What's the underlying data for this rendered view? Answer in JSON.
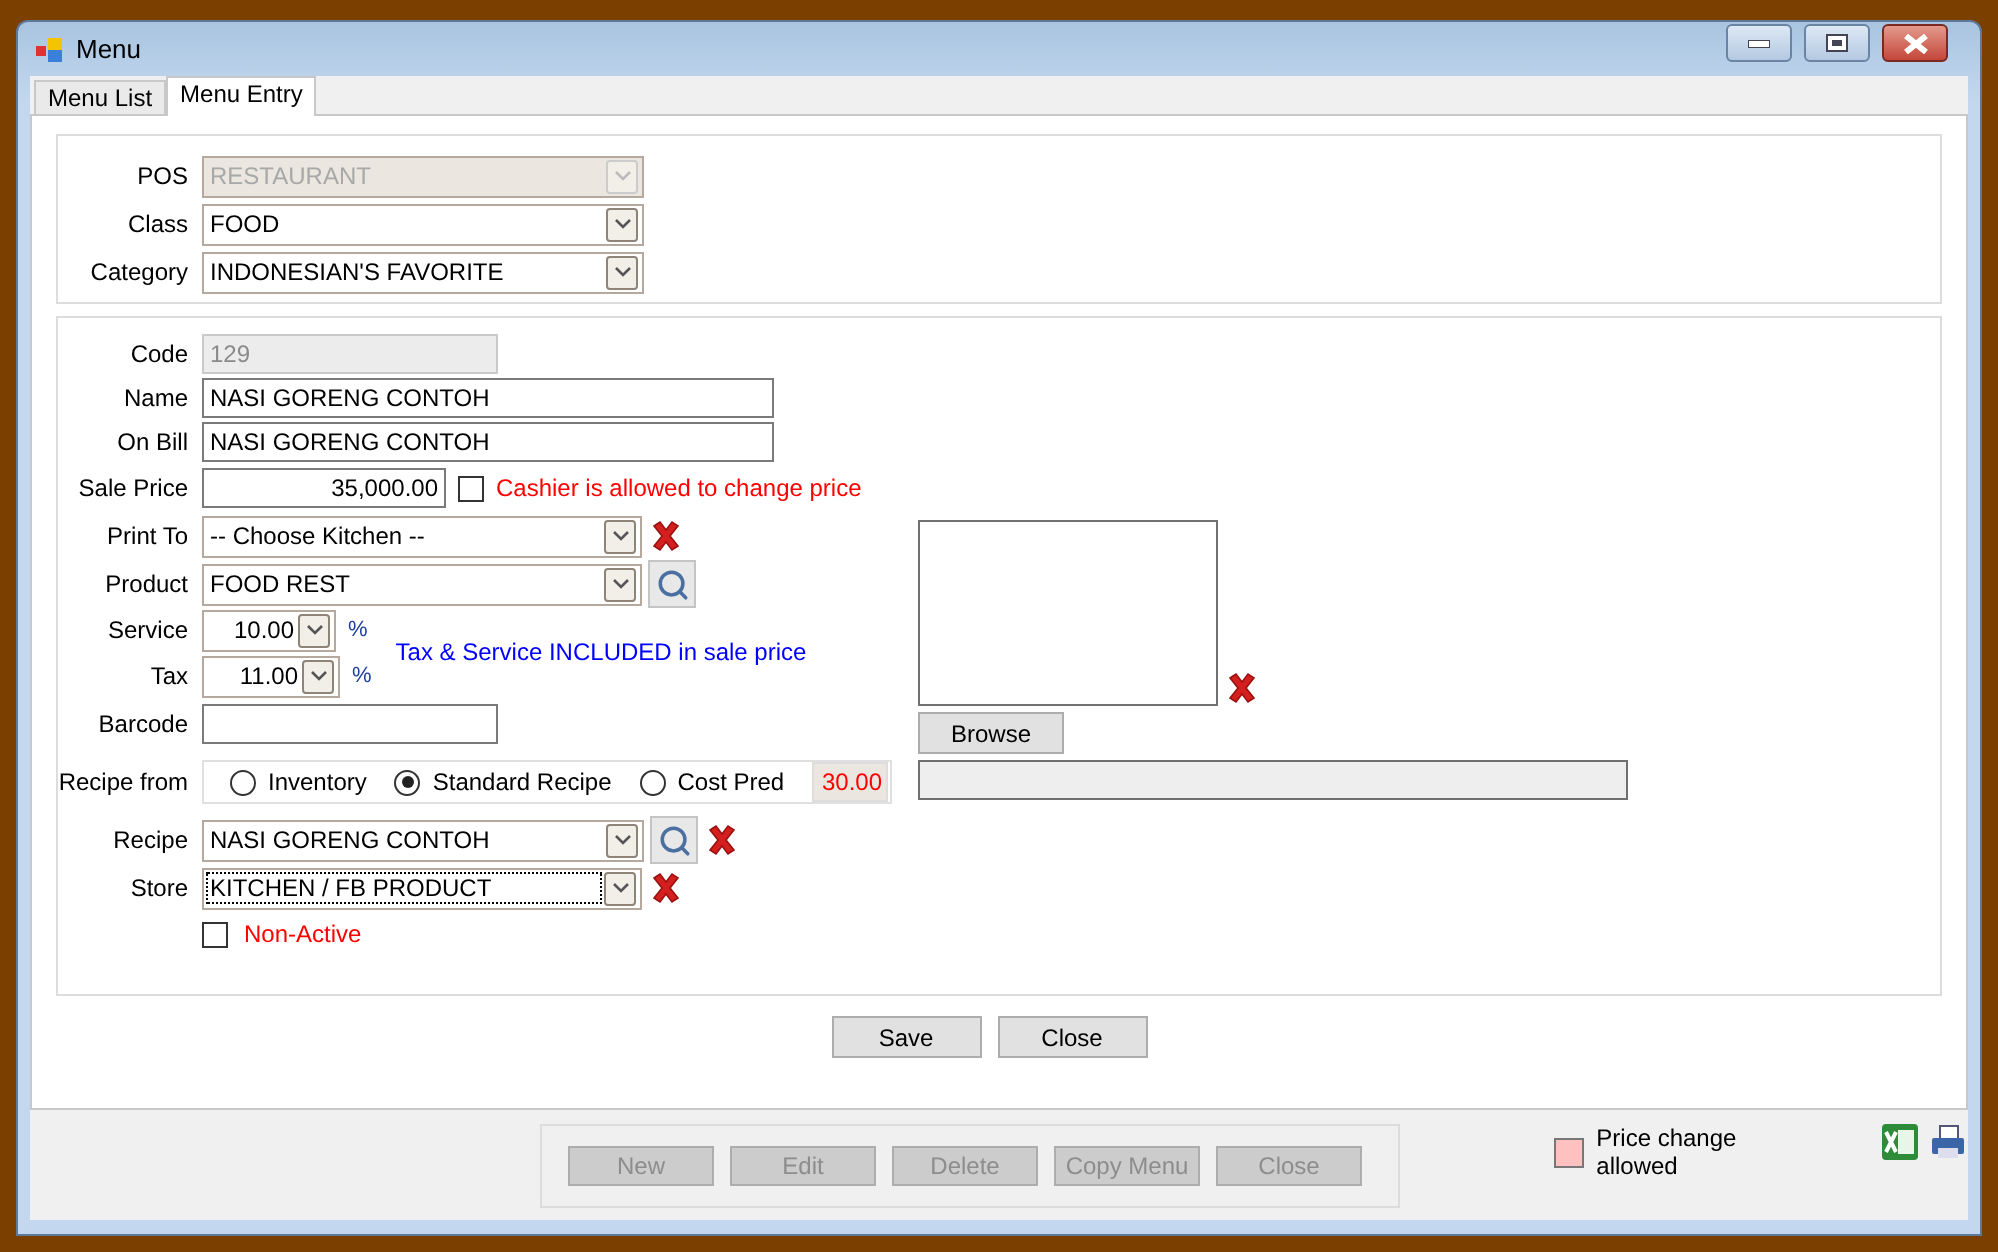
{
  "window": {
    "title": "Menu"
  },
  "tabs": [
    {
      "label": "Menu List",
      "selected": false
    },
    {
      "label": "Menu Entry",
      "selected": true
    }
  ],
  "header": [
    {
      "label": "POS",
      "value": "RESTAURANT",
      "disabled": true
    },
    {
      "label": "Class",
      "value": "FOOD",
      "disabled": false
    },
    {
      "label": "Category",
      "value": "INDONESIAN'S FAVORITE",
      "disabled": false
    }
  ],
  "code": {
    "label": "Code",
    "value": "129"
  },
  "name": {
    "label": "Name",
    "value": "NASI GORENG CONTOH"
  },
  "on_bill": {
    "label": "On Bill",
    "value": "NASI GORENG CONTOH"
  },
  "sale_price": {
    "label": "Sale Price",
    "value": "35,000.00",
    "allow_change": {
      "label": "Cashier is allowed to change price",
      "checked": false
    }
  },
  "print_to": {
    "label": "Print To",
    "value": "-- Choose Kitchen --"
  },
  "product": {
    "label": "Product",
    "value": "FOOD REST"
  },
  "service": {
    "label": "Service",
    "value": "10.00",
    "unit": "%"
  },
  "tax": {
    "label": "Tax",
    "value": "11.00",
    "unit": "%"
  },
  "tax_note": "Tax & Service INCLUDED in sale price",
  "barcode": {
    "label": "Barcode"
  },
  "recipe_from": {
    "label": "Recipe from",
    "options": [
      {
        "label": "Inventory",
        "selected": false
      },
      {
        "label": "Standard Recipe",
        "selected": true
      },
      {
        "label": "Cost Pred",
        "selected": false
      }
    ],
    "cost_pred": "30.00"
  },
  "recipe": {
    "label": "Recipe",
    "value": "NASI GORENG CONTOH"
  },
  "store": {
    "label": "Store",
    "value": "KITCHEN / FB PRODUCT"
  },
  "non_active": {
    "label": "Non-Active",
    "checked": false
  },
  "image": {
    "button": "Browse"
  },
  "actions": [
    "Save",
    "Close"
  ],
  "toolbar": [
    {
      "label": "New",
      "disabled": true
    },
    {
      "label": "Edit",
      "disabled": true
    },
    {
      "label": "Delete",
      "disabled": true
    },
    {
      "label": "Copy Menu",
      "disabled": true
    },
    {
      "label": "Close",
      "disabled": true
    }
  ],
  "legend": {
    "label": "Price change allowed",
    "color": "#ffc0c0"
  }
}
